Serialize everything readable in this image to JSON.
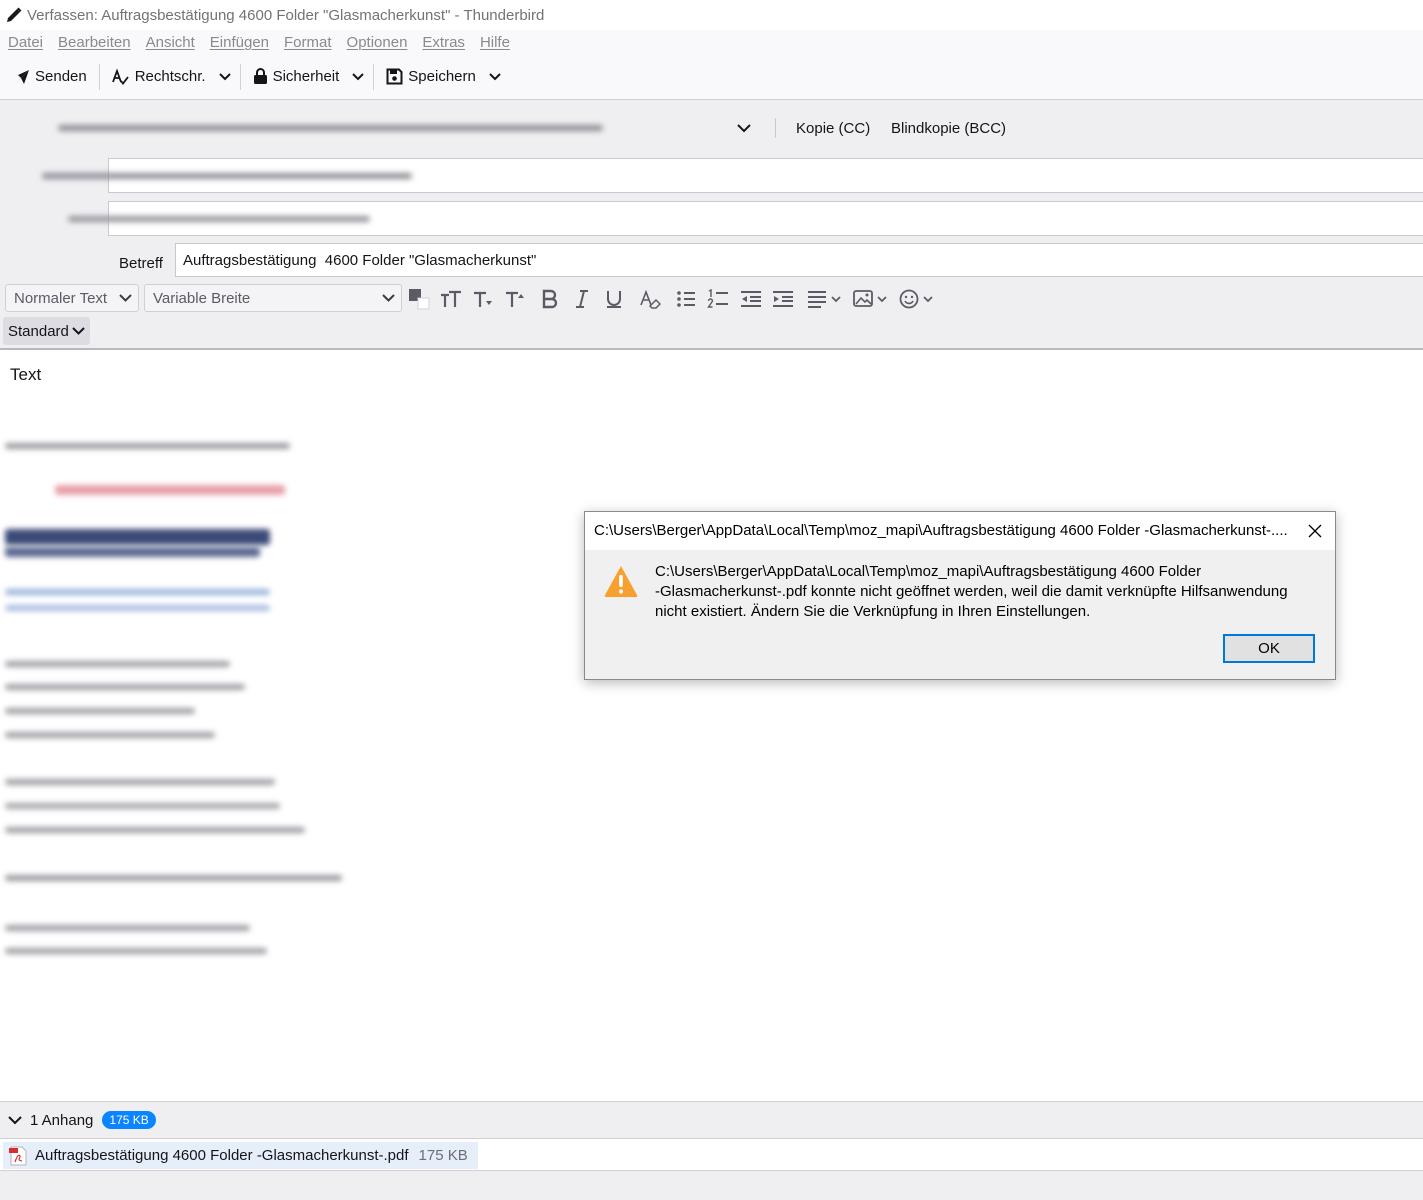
{
  "window": {
    "title": "Verfassen: Auftragsbestätigung 4600 Folder \"Glasmacherkunst\" - Thunderbird"
  },
  "menu": [
    "Datei",
    "Bearbeiten",
    "Ansicht",
    "Einfügen",
    "Format",
    "Optionen",
    "Extras",
    "Hilfe"
  ],
  "toolbar": {
    "send": "Senden",
    "spell": "Rechtschr.",
    "security": "Sicherheit",
    "save": "Speichern"
  },
  "headers": {
    "cc": "Kopie (CC)",
    "bcc": "Blindkopie (BCC)",
    "subject_label": "Betreff",
    "subject_value": "Auftragsbestätigung  4600 Folder \"Glasmacherkunst\""
  },
  "format": {
    "paragraph": "Normaler Text",
    "font": "Variable Breite",
    "standard": "Standard"
  },
  "body": {
    "text": "Text"
  },
  "attachments": {
    "count_label": "1 Anhang",
    "total_size": "175 KB",
    "file_name": "Auftragsbestätigung  4600 Folder -Glasmacherkunst-.pdf",
    "file_size": "175 KB"
  },
  "dialog": {
    "title": "C:\\Users\\Berger\\AppData\\Local\\Temp\\moz_mapi\\Auftragsbestätigung 4600 Folder -Glasmacherkunst-....",
    "message_line1": "C:\\Users\\Berger\\AppData\\Local\\Temp\\moz_mapi\\Auftragsbestätigung  4600 Folder",
    "message_line2": "-Glasmacherkunst-.pdf konnte nicht geöffnet werden, weil die damit verknüpfte Hilfsanwendung",
    "message_line3": "nicht existiert. Ändern Sie die Verknüpfung in Ihren Einstellungen.",
    "ok": "OK"
  },
  "colors": {
    "accent": "#0a84ff",
    "warning": "#f7a030",
    "dialog_focus": "#0078d7"
  }
}
